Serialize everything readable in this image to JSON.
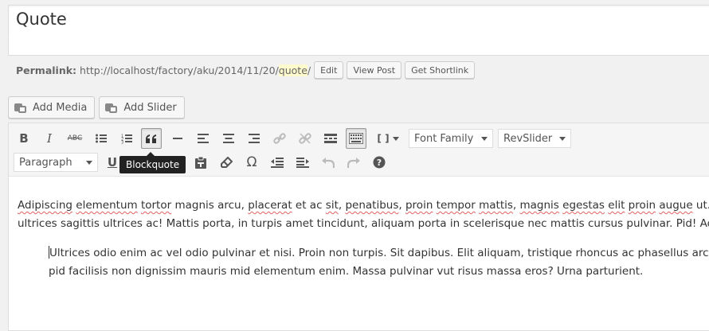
{
  "title": "Quote",
  "permalink": {
    "label": "Permalink:",
    "url_prefix": "http://localhost/factory/aku/2014/11/20/",
    "slug": "quote",
    "url_suffix": "/",
    "buttons": {
      "edit": "Edit",
      "view_post": "View Post",
      "get_shortlink": "Get Shortlink"
    }
  },
  "media_buttons": {
    "add_media": "Add Media",
    "add_slider": "Add Slider"
  },
  "toolbar": {
    "row1": [
      "bold",
      "italic",
      "strikethrough",
      "bullet-list",
      "numbered-list",
      "blockquote",
      "horizontal-line",
      "align-left",
      "align-center",
      "align-right",
      "insert-link",
      "remove-link",
      "read-more",
      "toolbar-toggle",
      "shortcode"
    ],
    "font_family": "Font Family",
    "revslider": "RevSlider",
    "format_select": "Paragraph",
    "tooltip": "Blockquote"
  },
  "content": {
    "paragraph_line1": [
      {
        "t": "Adipiscing",
        "s": true
      },
      {
        "t": " "
      },
      {
        "t": "elementum",
        "s": true
      },
      {
        "t": " "
      },
      {
        "t": "tortor",
        "s": true
      },
      {
        "t": " magnis arcu, "
      },
      {
        "t": "placerat",
        "s": true
      },
      {
        "t": " et ac "
      },
      {
        "t": "sit",
        "s": true
      },
      {
        "t": ", "
      },
      {
        "t": "penatibus",
        "s": true
      },
      {
        "t": ", "
      },
      {
        "t": "proin",
        "s": true
      },
      {
        "t": " "
      },
      {
        "t": "tempor",
        "s": true
      },
      {
        "t": " "
      },
      {
        "t": "mattis",
        "s": true
      },
      {
        "t": ", "
      },
      {
        "t": "magnis",
        "s": true
      },
      {
        "t": " "
      },
      {
        "t": "egestas",
        "s": true
      },
      {
        "t": " "
      },
      {
        "t": "elit",
        "s": true
      },
      {
        "t": " "
      },
      {
        "t": "proin",
        "s": true
      },
      {
        "t": " "
      },
      {
        "t": "augue",
        "s": true
      },
      {
        "t": " ut. Ridicu"
      }
    ],
    "paragraph_line2": "ultrices sagittis ultrices ac! Mattis porta, in turpis amet tincidunt, aliquam porta in scelerisque nec mattis cursus pulvinar. Pid! Ac.",
    "quote_line1": "Ultrices odio enim ac vel odio pulvinar et nisi. Proin non turpis. Sit dapibus. Elit aliquam, tristique rhoncus ac phasellus arcu diar",
    "quote_line2": "pid facilisis non dignissim mauris mid elementum enim. Massa pulvinar vut risus massa eros? Urna parturient."
  }
}
